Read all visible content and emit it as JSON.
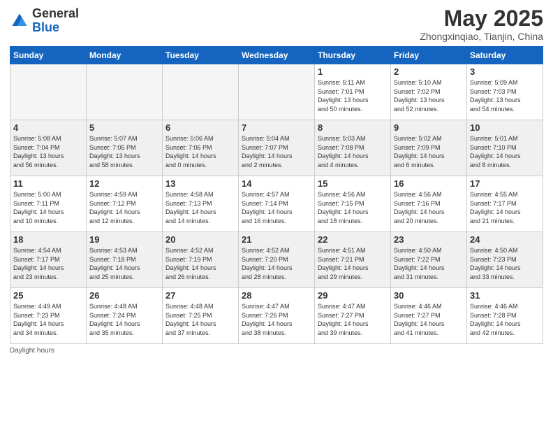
{
  "header": {
    "logo_general": "General",
    "logo_blue": "Blue",
    "month_title": "May 2025",
    "location": "Zhongxinqiao, Tianjin, China"
  },
  "weekdays": [
    "Sunday",
    "Monday",
    "Tuesday",
    "Wednesday",
    "Thursday",
    "Friday",
    "Saturday"
  ],
  "weeks": [
    [
      {
        "day": "",
        "info": "",
        "empty": true
      },
      {
        "day": "",
        "info": "",
        "empty": true
      },
      {
        "day": "",
        "info": "",
        "empty": true
      },
      {
        "day": "",
        "info": "",
        "empty": true
      },
      {
        "day": "1",
        "info": "Sunrise: 5:11 AM\nSunset: 7:01 PM\nDaylight: 13 hours\nand 50 minutes.",
        "empty": false
      },
      {
        "day": "2",
        "info": "Sunrise: 5:10 AM\nSunset: 7:02 PM\nDaylight: 13 hours\nand 52 minutes.",
        "empty": false
      },
      {
        "day": "3",
        "info": "Sunrise: 5:09 AM\nSunset: 7:03 PM\nDaylight: 13 hours\nand 54 minutes.",
        "empty": false
      }
    ],
    [
      {
        "day": "4",
        "info": "Sunrise: 5:08 AM\nSunset: 7:04 PM\nDaylight: 13 hours\nand 56 minutes.",
        "empty": false,
        "gray": true
      },
      {
        "day": "5",
        "info": "Sunrise: 5:07 AM\nSunset: 7:05 PM\nDaylight: 13 hours\nand 58 minutes.",
        "empty": false,
        "gray": true
      },
      {
        "day": "6",
        "info": "Sunrise: 5:06 AM\nSunset: 7:06 PM\nDaylight: 14 hours\nand 0 minutes.",
        "empty": false,
        "gray": true
      },
      {
        "day": "7",
        "info": "Sunrise: 5:04 AM\nSunset: 7:07 PM\nDaylight: 14 hours\nand 2 minutes.",
        "empty": false,
        "gray": true
      },
      {
        "day": "8",
        "info": "Sunrise: 5:03 AM\nSunset: 7:08 PM\nDaylight: 14 hours\nand 4 minutes.",
        "empty": false,
        "gray": true
      },
      {
        "day": "9",
        "info": "Sunrise: 5:02 AM\nSunset: 7:09 PM\nDaylight: 14 hours\nand 6 minutes.",
        "empty": false,
        "gray": true
      },
      {
        "day": "10",
        "info": "Sunrise: 5:01 AM\nSunset: 7:10 PM\nDaylight: 14 hours\nand 8 minutes.",
        "empty": false,
        "gray": true
      }
    ],
    [
      {
        "day": "11",
        "info": "Sunrise: 5:00 AM\nSunset: 7:11 PM\nDaylight: 14 hours\nand 10 minutes.",
        "empty": false
      },
      {
        "day": "12",
        "info": "Sunrise: 4:59 AM\nSunset: 7:12 PM\nDaylight: 14 hours\nand 12 minutes.",
        "empty": false
      },
      {
        "day": "13",
        "info": "Sunrise: 4:58 AM\nSunset: 7:13 PM\nDaylight: 14 hours\nand 14 minutes.",
        "empty": false
      },
      {
        "day": "14",
        "info": "Sunrise: 4:57 AM\nSunset: 7:14 PM\nDaylight: 14 hours\nand 16 minutes.",
        "empty": false
      },
      {
        "day": "15",
        "info": "Sunrise: 4:56 AM\nSunset: 7:15 PM\nDaylight: 14 hours\nand 18 minutes.",
        "empty": false
      },
      {
        "day": "16",
        "info": "Sunrise: 4:56 AM\nSunset: 7:16 PM\nDaylight: 14 hours\nand 20 minutes.",
        "empty": false
      },
      {
        "day": "17",
        "info": "Sunrise: 4:55 AM\nSunset: 7:17 PM\nDaylight: 14 hours\nand 21 minutes.",
        "empty": false
      }
    ],
    [
      {
        "day": "18",
        "info": "Sunrise: 4:54 AM\nSunset: 7:17 PM\nDaylight: 14 hours\nand 23 minutes.",
        "empty": false,
        "gray": true
      },
      {
        "day": "19",
        "info": "Sunrise: 4:53 AM\nSunset: 7:18 PM\nDaylight: 14 hours\nand 25 minutes.",
        "empty": false,
        "gray": true
      },
      {
        "day": "20",
        "info": "Sunrise: 4:52 AM\nSunset: 7:19 PM\nDaylight: 14 hours\nand 26 minutes.",
        "empty": false,
        "gray": true
      },
      {
        "day": "21",
        "info": "Sunrise: 4:52 AM\nSunset: 7:20 PM\nDaylight: 14 hours\nand 28 minutes.",
        "empty": false,
        "gray": true
      },
      {
        "day": "22",
        "info": "Sunrise: 4:51 AM\nSunset: 7:21 PM\nDaylight: 14 hours\nand 29 minutes.",
        "empty": false,
        "gray": true
      },
      {
        "day": "23",
        "info": "Sunrise: 4:50 AM\nSunset: 7:22 PM\nDaylight: 14 hours\nand 31 minutes.",
        "empty": false,
        "gray": true
      },
      {
        "day": "24",
        "info": "Sunrise: 4:50 AM\nSunset: 7:23 PM\nDaylight: 14 hours\nand 33 minutes.",
        "empty": false,
        "gray": true
      }
    ],
    [
      {
        "day": "25",
        "info": "Sunrise: 4:49 AM\nSunset: 7:23 PM\nDaylight: 14 hours\nand 34 minutes.",
        "empty": false
      },
      {
        "day": "26",
        "info": "Sunrise: 4:48 AM\nSunset: 7:24 PM\nDaylight: 14 hours\nand 35 minutes.",
        "empty": false
      },
      {
        "day": "27",
        "info": "Sunrise: 4:48 AM\nSunset: 7:25 PM\nDaylight: 14 hours\nand 37 minutes.",
        "empty": false
      },
      {
        "day": "28",
        "info": "Sunrise: 4:47 AM\nSunset: 7:26 PM\nDaylight: 14 hours\nand 38 minutes.",
        "empty": false
      },
      {
        "day": "29",
        "info": "Sunrise: 4:47 AM\nSunset: 7:27 PM\nDaylight: 14 hours\nand 39 minutes.",
        "empty": false
      },
      {
        "day": "30",
        "info": "Sunrise: 4:46 AM\nSunset: 7:27 PM\nDaylight: 14 hours\nand 41 minutes.",
        "empty": false
      },
      {
        "day": "31",
        "info": "Sunrise: 4:46 AM\nSunset: 7:28 PM\nDaylight: 14 hours\nand 42 minutes.",
        "empty": false
      }
    ]
  ],
  "footer": {
    "note": "Daylight hours"
  }
}
